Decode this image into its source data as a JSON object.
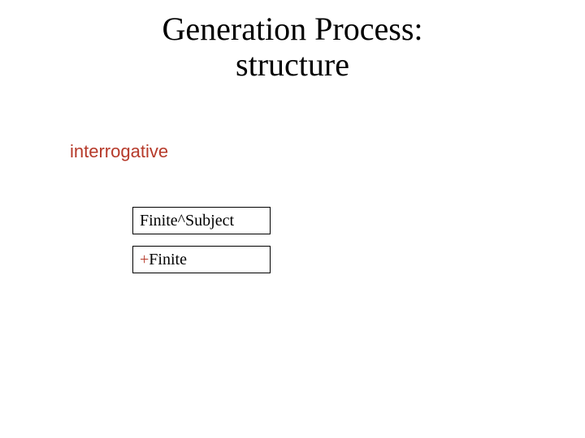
{
  "title": {
    "line1": "Generation Process:",
    "line2": "structure"
  },
  "label_interrogative": "interrogative",
  "box_finite_subject": "Finite^Subject",
  "box_plus_finite": {
    "plus": "+",
    "rest": "Finite"
  }
}
